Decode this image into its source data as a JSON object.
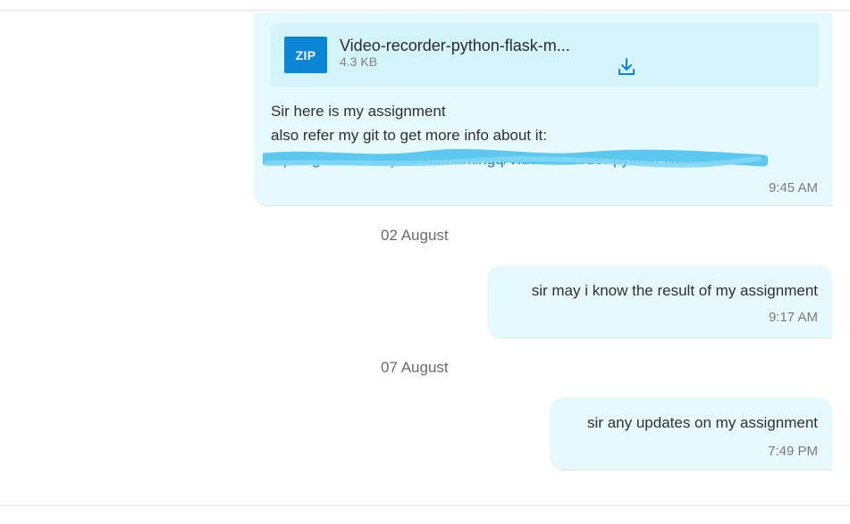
{
  "messages": [
    {
      "attachment": {
        "type_badge": "ZIP",
        "file_name": "Video-recorder-python-flask-m...",
        "file_size": "4.3 KB",
        "icon": "download-icon"
      },
      "lines": [
        "Sir here is my assignment",
        "also refer my git to get more info about it:"
      ],
      "link": "https://github.com/parthkumarkingq/Video-recorder-python-flask",
      "time": "9:45 AM"
    },
    {
      "date_separator": "02 August",
      "text": "sir may i know the result of my assignment",
      "time": "9:17 AM"
    },
    {
      "date_separator": "07 August",
      "text": "sir any updates on my assignment",
      "time": "7:49 PM"
    }
  ],
  "colors": {
    "bubble": "#e6fafe",
    "attachment_bg": "#d4f4fb",
    "zip_badge": "#0b86d6",
    "link": "#1976b8",
    "redaction": "#5cc8f0"
  }
}
